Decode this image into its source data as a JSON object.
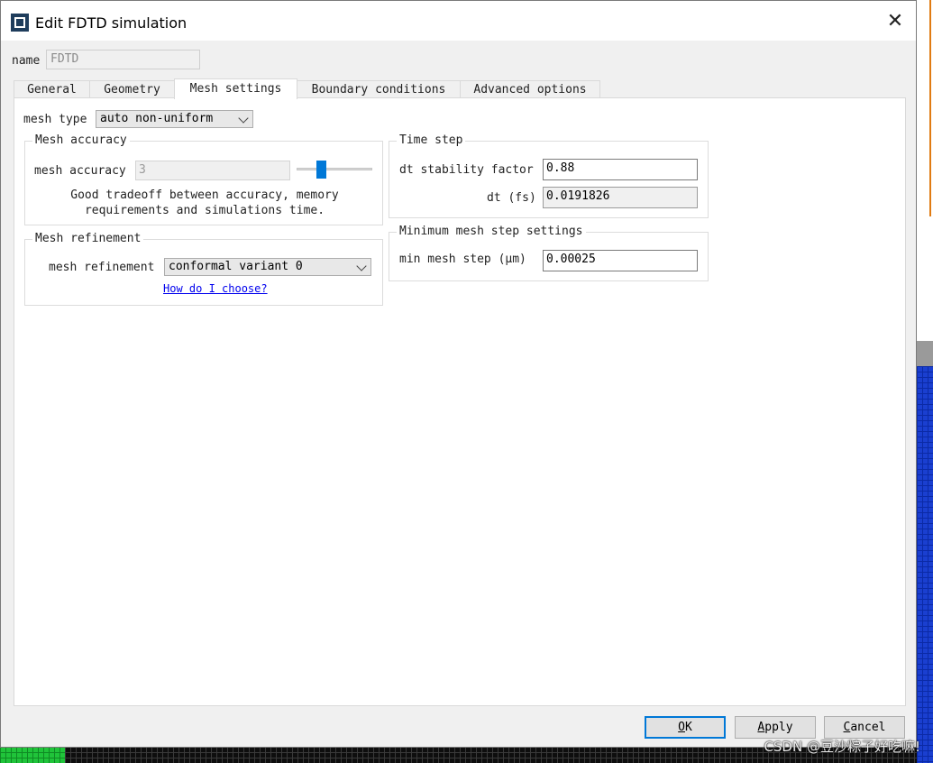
{
  "dialog": {
    "title": "Edit FDTD simulation",
    "close_glyph": "✕",
    "name_label": "name",
    "name_value": "FDTD"
  },
  "tabs": [
    {
      "label": "General"
    },
    {
      "label": "Geometry"
    },
    {
      "label": "Mesh settings",
      "active": true
    },
    {
      "label": "Boundary conditions"
    },
    {
      "label": "Advanced options"
    }
  ],
  "mesh": {
    "type_label": "mesh type",
    "type_value": "auto non-uniform",
    "accuracy_group": "Mesh accuracy",
    "accuracy_label": "mesh accuracy",
    "accuracy_value": "3",
    "accuracy_slider_fraction": 0.3,
    "hint_line1": "Good tradeoff between accuracy, memory",
    "hint_line2": "requirements and simulations time.",
    "refinement_group": "Mesh refinement",
    "refinement_label": "mesh refinement",
    "refinement_value": "conformal variant 0",
    "help_link": "How do I choose?"
  },
  "timestep": {
    "group": "Time step",
    "stability_label": "dt stability factor",
    "stability_value": "0.88",
    "dt_label": "dt (fs)",
    "dt_value": "0.0191826"
  },
  "minmesh": {
    "group": "Minimum mesh step settings",
    "label": "min mesh step (μm)",
    "value": "0.00025"
  },
  "buttons": {
    "ok_acc": "O",
    "ok_rest": "K",
    "apply_acc": "A",
    "apply_rest": "pply",
    "cancel_acc": "C",
    "cancel_rest": "ancel"
  },
  "watermark": "CSDN @豆沙粽子好吃嘛!",
  "icons": {
    "app": "app-window-icon",
    "close": "close-icon",
    "dropdown": "chevron-down-icon"
  },
  "colors": {
    "accent": "#0078d7",
    "link": "#0000ee"
  }
}
